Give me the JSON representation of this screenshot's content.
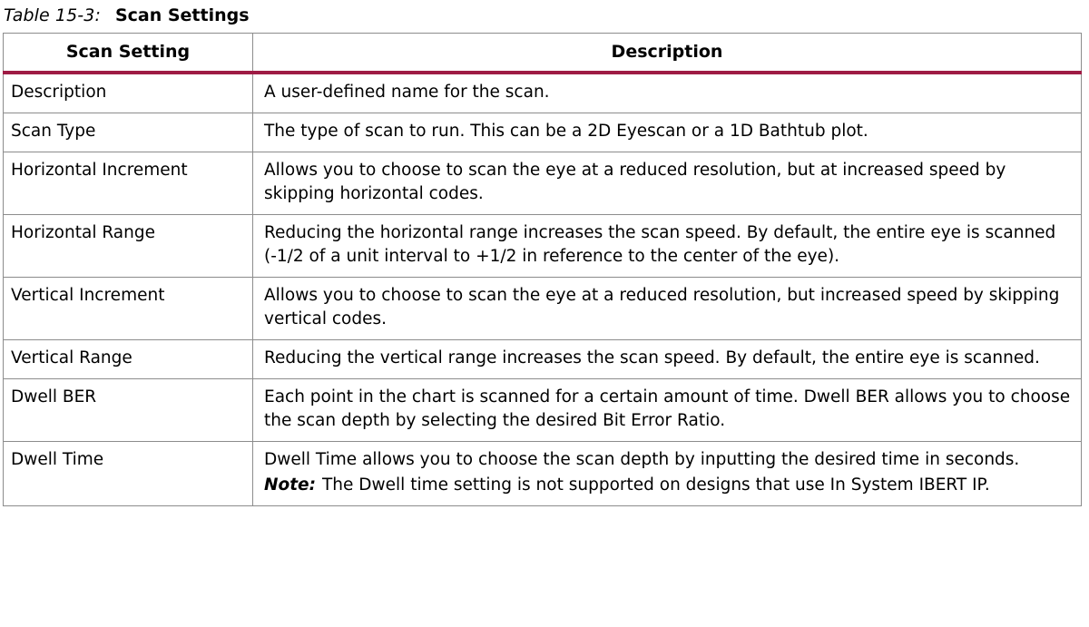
{
  "caption": {
    "label": "Table 15-3:",
    "title": "Scan Settings"
  },
  "colors": {
    "header_rule": "#9e1b44",
    "grid": "#8c8c8c",
    "text": "#000000",
    "background": "#ffffff"
  },
  "table": {
    "columns": [
      {
        "key": "setting",
        "header": "Scan Setting",
        "align": "center"
      },
      {
        "key": "description",
        "header": "Description",
        "align": "center"
      }
    ],
    "rows": [
      {
        "setting": "Description",
        "description": "A user-defined name for the scan."
      },
      {
        "setting": "Scan Type",
        "description": "The type of scan to run. This can be a 2D Eyescan or a 1D Bathtub plot."
      },
      {
        "setting": "Horizontal Increment",
        "description": "Allows you to choose to scan the eye at a reduced resolution, but at increased speed by skipping horizontal codes."
      },
      {
        "setting": "Horizontal Range",
        "description": "Reducing the horizontal range increases the scan speed. By default, the entire eye is scanned (-1/2 of a unit interval to +1/2 in reference to the center of the eye)."
      },
      {
        "setting": "Vertical Increment",
        "description": "Allows you to choose to scan the eye at a reduced resolution, but increased speed by skipping vertical codes."
      },
      {
        "setting": "Vertical Range",
        "description": "Reducing the vertical range increases the scan speed. By default, the entire eye is scanned."
      },
      {
        "setting": "Dwell BER",
        "description": "Each point in the chart is scanned for a certain amount of time. Dwell BER allows you to choose the scan depth by selecting the desired Bit Error Ratio."
      },
      {
        "setting": "Dwell Time",
        "description": "Dwell Time allows you to choose the scan depth by inputting the desired time in seconds.",
        "note_label": "Note:",
        "note_text": "The Dwell time setting is not supported on designs that use In System IBERT IP."
      }
    ]
  }
}
